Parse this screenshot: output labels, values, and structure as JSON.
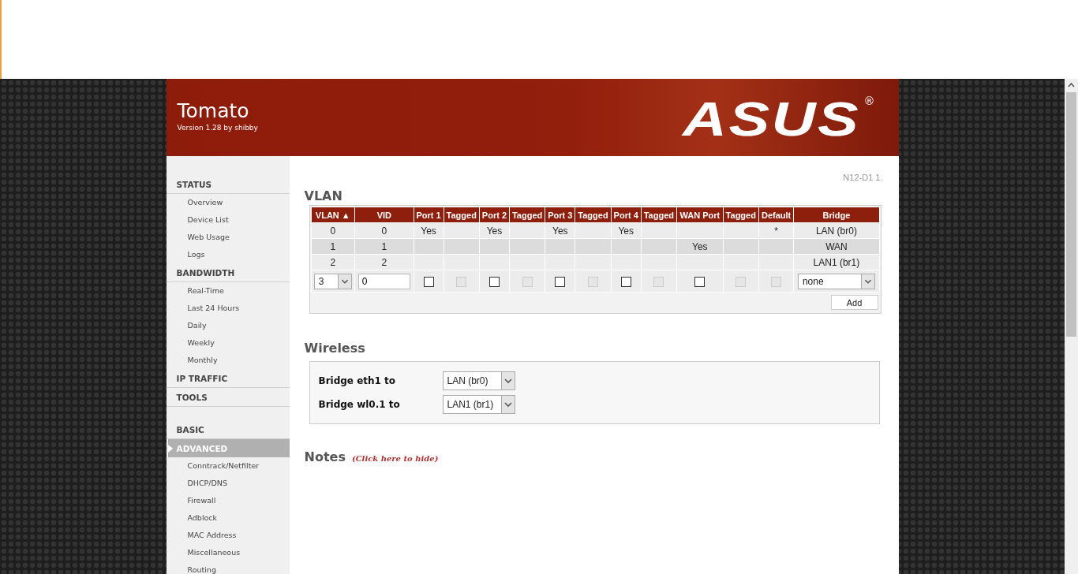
{
  "header": {
    "title": "Tomato",
    "version": "Version 1.28 by shibby",
    "logo": "ASUS",
    "logo_mark": "®"
  },
  "sidebar": {
    "groups": [
      [
        {
          "label": "STATUS",
          "selected": false,
          "items": [
            "Overview",
            "Device List",
            "Web Usage",
            "Logs"
          ]
        },
        {
          "label": "BANDWIDTH",
          "selected": false,
          "items": [
            "Real-Time",
            "Last 24 Hours",
            "Daily",
            "Weekly",
            "Monthly"
          ]
        },
        {
          "label": "IP TRAFFIC",
          "selected": false
        },
        {
          "label": "TOOLS",
          "selected": false
        }
      ],
      [
        {
          "label": "BASIC",
          "selected": false
        },
        {
          "label": "ADVANCED",
          "selected": true,
          "items": [
            "Conntrack/Netfilter",
            "DHCP/DNS",
            "Firewall",
            "Adblock",
            "MAC Address",
            "Miscellaneous",
            "Routing"
          ]
        }
      ]
    ]
  },
  "model": "N12-D1 1.",
  "vlan": {
    "title": "VLAN",
    "columns": [
      "VLAN ▲",
      "VID",
      "Port 1",
      "Tagged",
      "Port 2",
      "Tagged",
      "Port 3",
      "Tagged",
      "Port 4",
      "Tagged",
      "WAN Port",
      "Tagged",
      "Default",
      "Bridge"
    ],
    "rows": [
      [
        "0",
        "0",
        "Yes",
        "",
        "Yes",
        "",
        "Yes",
        "",
        "Yes",
        "",
        "",
        "",
        "*",
        "LAN (br0)"
      ],
      [
        "1",
        "1",
        "",
        "",
        "",
        "",
        "",
        "",
        "",
        "",
        "Yes",
        "",
        "",
        "WAN"
      ],
      [
        "2",
        "2",
        "",
        "",
        "",
        "",
        "",
        "",
        "",
        "",
        "",
        "",
        "",
        "LAN1 (br1)"
      ]
    ],
    "editor": {
      "vlan": "3",
      "vid": "0",
      "checks": [
        {
          "checked": false,
          "disabled": false
        },
        {
          "checked": false,
          "disabled": true
        },
        {
          "checked": false,
          "disabled": false
        },
        {
          "checked": false,
          "disabled": true
        },
        {
          "checked": false,
          "disabled": false
        },
        {
          "checked": false,
          "disabled": true
        },
        {
          "checked": false,
          "disabled": false
        },
        {
          "checked": false,
          "disabled": true
        },
        {
          "checked": false,
          "disabled": false
        },
        {
          "checked": false,
          "disabled": true
        },
        {
          "checked": false,
          "disabled": true
        }
      ],
      "bridge": "none"
    },
    "add_button": "Add"
  },
  "wireless": {
    "title": "Wireless",
    "rows": [
      {
        "label": "Bridge eth1 to",
        "value": "LAN (br0)"
      },
      {
        "label": "Bridge wl0.1 to",
        "value": "LAN1 (br1)"
      }
    ]
  },
  "notes": {
    "title": "Notes",
    "link": "(Click here to hide)"
  }
}
